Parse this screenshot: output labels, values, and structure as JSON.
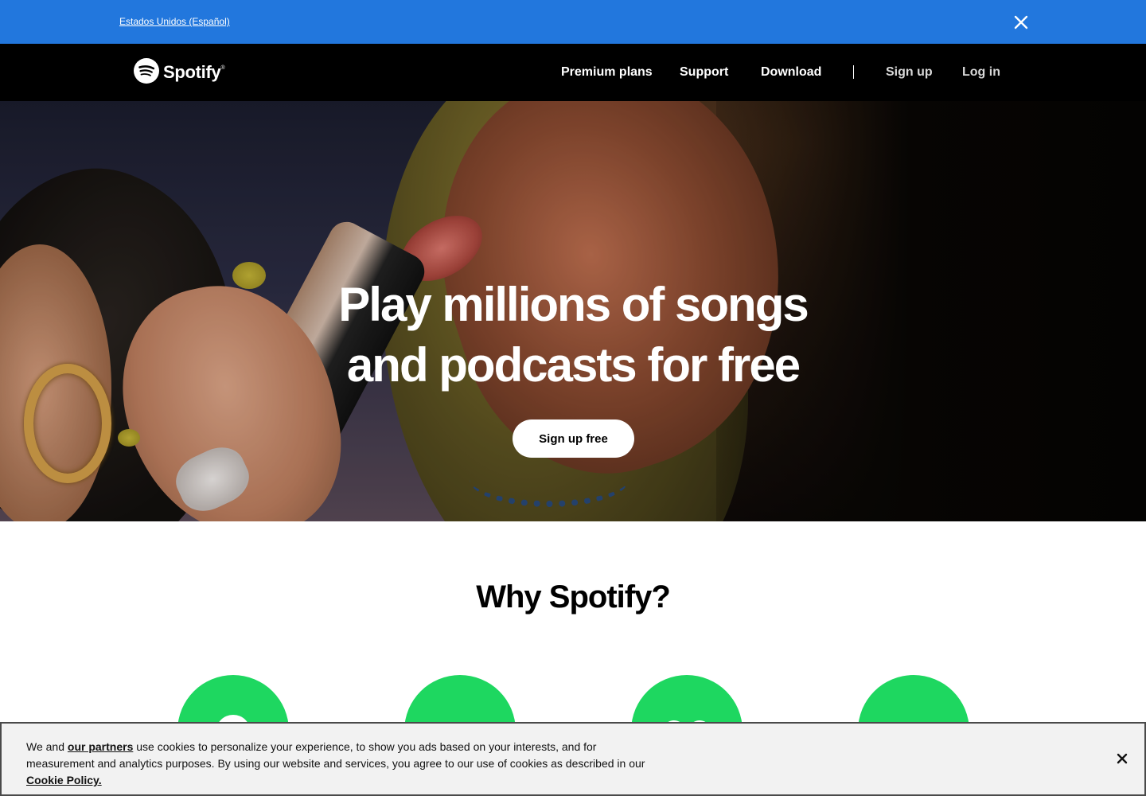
{
  "language_banner": {
    "link_label": "Estados Unidos (Español)",
    "close_icon": "close-icon",
    "background_color": "#2277dd"
  },
  "header": {
    "logo_text": "Spotify",
    "logo_tm": "®",
    "nav": {
      "premium": "Premium plans",
      "support": "Support",
      "download": "Download",
      "signup": "Sign up",
      "login": "Log in"
    }
  },
  "hero": {
    "title_line1": "Play millions of songs",
    "title_line2": "and podcasts for free",
    "cta_label": "Sign up free"
  },
  "why": {
    "title": "Why Spotify?",
    "features": [
      {
        "icon": "speech-icon"
      },
      {
        "icon": "play-skip-icon"
      },
      {
        "icon": "heart-icon"
      },
      {
        "icon": "lightning-icon"
      }
    ],
    "accent_color": "#1ed760"
  },
  "cookie_banner": {
    "text_before_link": "We and ",
    "partners_link": "our partners",
    "text_middle": " use cookies to personalize your experience, to show you ads based on your interests, and for measurement and analytics purposes. By using our website and services, you agree to our use of cookies as described in our ",
    "policy_link": "Cookie Policy.",
    "close_icon": "close-icon"
  }
}
